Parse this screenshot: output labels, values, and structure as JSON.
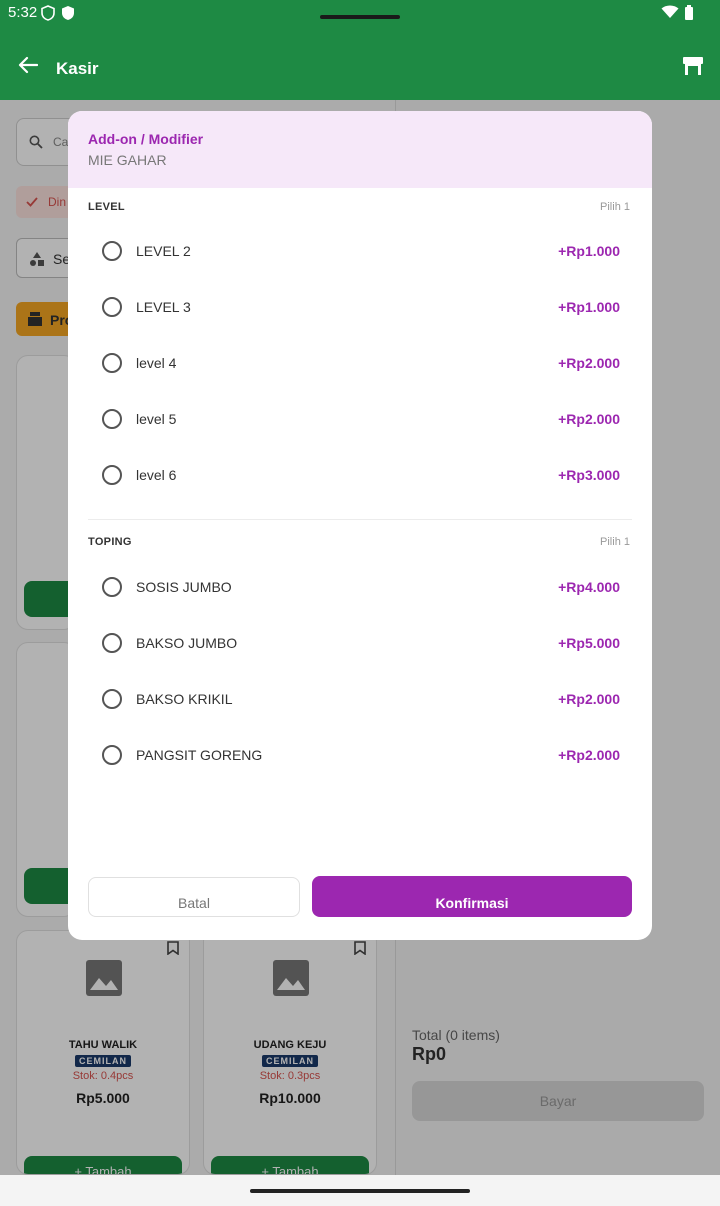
{
  "status_bar": {
    "time": "5:32"
  },
  "app_bar": {
    "title": "Kasir"
  },
  "background": {
    "search_placeholder": "Ca",
    "filter_chip": "Din",
    "select_label": "Se",
    "promo_chip": "Pro",
    "products": [
      {
        "name": "TAHU WALIK",
        "category": "CEMILAN",
        "stock": "Stok: 0.4pcs",
        "price": "Rp5.000",
        "add_label": "+ Tambah"
      },
      {
        "name": "UDANG KEJU",
        "category": "CEMILAN",
        "stock": "Stok: 0.3pcs",
        "price": "Rp10.000",
        "add_label": "+ Tambah"
      }
    ],
    "total_label": "Total (0 items)",
    "total_value": "Rp0",
    "pay_label": "Bayar"
  },
  "dialog": {
    "title": "Add-on / Modifier",
    "subtitle": "MIE GAHAR",
    "sections": [
      {
        "title": "LEVEL",
        "hint": "Pilih 1",
        "options": [
          {
            "label": "LEVEL 2",
            "price": "+Rp1.000"
          },
          {
            "label": "LEVEL 3",
            "price": "+Rp1.000"
          },
          {
            "label": "level 4",
            "price": "+Rp2.000"
          },
          {
            "label": "level 5",
            "price": "+Rp2.000"
          },
          {
            "label": "level 6",
            "price": "+Rp3.000"
          }
        ]
      },
      {
        "title": "TOPING",
        "hint": "Pilih 1",
        "options": [
          {
            "label": "SOSIS JUMBO",
            "price": "+Rp4.000"
          },
          {
            "label": "BAKSO JUMBO",
            "price": "+Rp5.000"
          },
          {
            "label": "BAKSO KRIKIL",
            "price": "+Rp2.000"
          },
          {
            "label": "PANGSIT GORENG",
            "price": "+Rp2.000"
          }
        ]
      }
    ],
    "cancel_label": "Batal",
    "confirm_label": "Konfirmasi"
  },
  "colors": {
    "primary_green": "#1e8a44",
    "accent_purple": "#9c27b0"
  }
}
